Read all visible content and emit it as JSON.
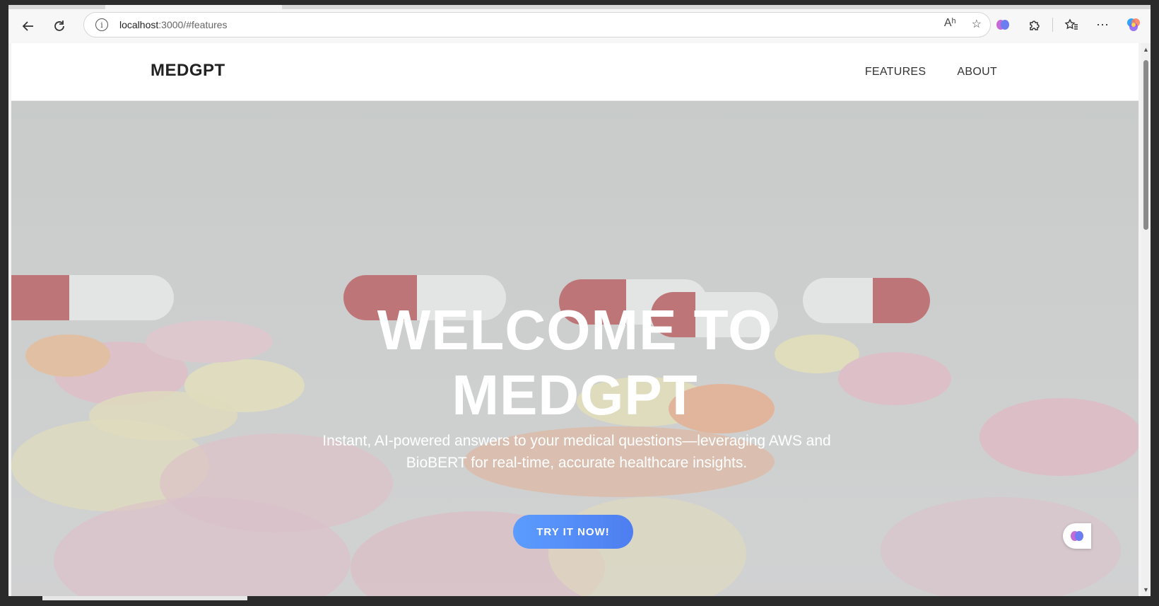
{
  "browser": {
    "url_host": "localhost",
    "url_path": ":3000/#features",
    "icons": {
      "back": "back-arrow-icon",
      "reload": "reload-icon",
      "info": "info-icon",
      "read_aloud": "read-aloud-icon",
      "favorite": "star-icon",
      "copilot_ext": "brain-icon",
      "extensions": "puzzle-icon",
      "favorites": "favorites-icon",
      "menu": "more-icon",
      "copilot": "copilot-icon"
    },
    "info_glyph": "i",
    "read_aloud_glyph": "Aʰ"
  },
  "site": {
    "logo": "MEDGPT",
    "nav": [
      {
        "label": "FEATURES"
      },
      {
        "label": "ABOUT"
      }
    ]
  },
  "hero": {
    "title_line1": "WELCOME TO",
    "title_line2": "MEDGPT",
    "subtitle": "Instant, AI-powered answers to your medical questions—leveraging AWS and BioBERT for real-time, accurate healthcare insights.",
    "cta_label": "TRY IT NOW!"
  },
  "colors": {
    "cta_start": "#5b9cff",
    "cta_end": "#4e7ef0"
  }
}
